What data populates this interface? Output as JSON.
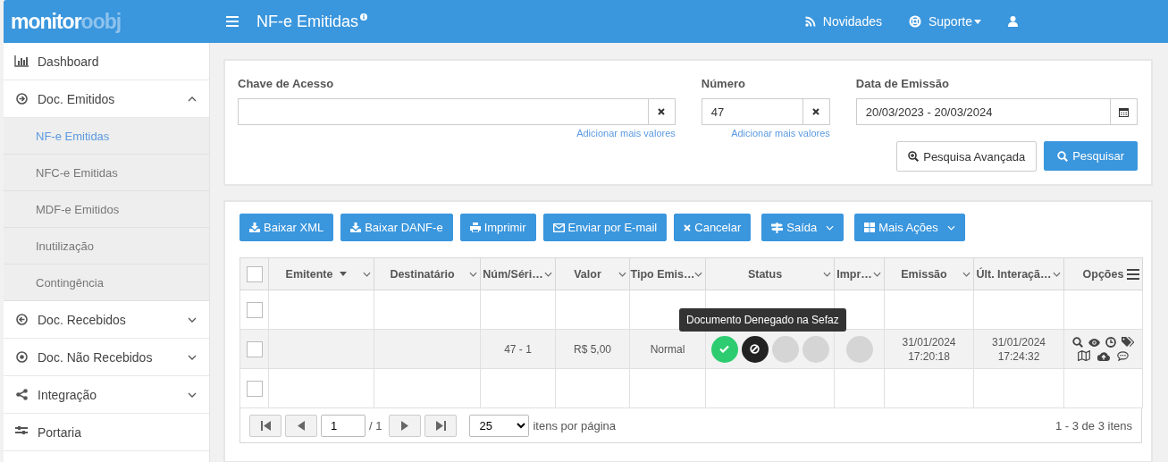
{
  "header": {
    "logo": {
      "primary": "monitor",
      "secondary": "oobj"
    },
    "title": "NF-e Emitidas",
    "nav": [
      {
        "kind": "news",
        "label": "Novidades"
      },
      {
        "kind": "support",
        "label": "Suporte",
        "dropdown": true
      },
      {
        "kind": "user"
      }
    ]
  },
  "sidebar": {
    "items": [
      {
        "kind": "link",
        "label": "Dashboard"
      },
      {
        "kind": "group",
        "label": "Doc. Emitidos",
        "expanded": true,
        "children": [
          {
            "label": "NF-e Emitidas",
            "selected": true
          },
          {
            "label": "NFC-e Emitidas",
            "selected": false
          },
          {
            "label": "MDF-e Emitidos",
            "selected": false
          },
          {
            "label": "Inutilização",
            "selected": false
          },
          {
            "label": "Contingência",
            "selected": false
          }
        ]
      },
      {
        "kind": "group",
        "label": "Doc. Recebidos",
        "expanded": false
      },
      {
        "kind": "group",
        "label": "Doc. Não Recebidos",
        "expanded": false
      },
      {
        "kind": "group",
        "label": "Integração",
        "expanded": false
      },
      {
        "kind": "link",
        "label": "Portaria"
      }
    ]
  },
  "filters": {
    "fields": [
      {
        "kind": "clearable",
        "label": "Chave de Acesso",
        "link": "Adicionar mais valores"
      },
      {
        "kind": "clearable",
        "label": "Número",
        "value": "47",
        "link": "Adicionar mais valores"
      },
      {
        "kind": "daterange",
        "label": "Data de Emissão",
        "value": "20/03/2023 - 20/03/2024"
      }
    ],
    "buttons": [
      {
        "kind": "default",
        "label": "Pesquisa Avançada"
      },
      {
        "kind": "primary",
        "label": "Pesquisar"
      }
    ]
  },
  "actions": [
    {
      "label": "Baixar XML",
      "dropdown": false
    },
    {
      "label": "Baixar DANF-e",
      "dropdown": false
    },
    {
      "label": "Imprimir",
      "dropdown": false
    },
    {
      "label": "Enviar por E-mail",
      "dropdown": false
    },
    {
      "label": "Cancelar",
      "dropdown": false
    },
    {
      "label": "Saída",
      "dropdown": true
    },
    {
      "label": "Mais Ações",
      "dropdown": true
    }
  ],
  "table": {
    "select_all": false,
    "columns": [
      {
        "label": "Emitente",
        "sorted": true,
        "kind": "filter"
      },
      {
        "label": "Destinatário",
        "sorted": false,
        "kind": "filter"
      },
      {
        "label": "Núm/Séri…",
        "sorted": false,
        "kind": "filter"
      },
      {
        "label": "Valor",
        "sorted": false,
        "kind": "filter"
      },
      {
        "label": "Tipo Emis…",
        "sorted": false,
        "kind": "filter"
      },
      {
        "label": "Status",
        "sorted": false,
        "kind": "filter"
      },
      {
        "label": "Impr…",
        "sorted": false,
        "kind": "filter"
      },
      {
        "label": "Emissão",
        "sorted": false,
        "kind": "filter"
      },
      {
        "label": "Últ. Interaçã…",
        "sorted": false,
        "kind": "filter"
      },
      {
        "label": "Opções",
        "sorted": false,
        "kind": "menu"
      }
    ],
    "rows": [
      {
        "checked": false,
        "highlighted": false,
        "options": false
      },
      {
        "checked": false,
        "highlighted": true,
        "options": true,
        "num_serie": "47 - 1",
        "valor": "R$ 5,00",
        "tipo": "Normal",
        "status": [
          {
            "kind": "authorized"
          },
          {
            "kind": "denied"
          },
          {
            "kind": "pending"
          },
          {
            "kind": "pending"
          }
        ],
        "impressao": {
          "kind": "pending"
        },
        "emissao": "31/01/2024\n17:20:18",
        "ultima_interacao": "31/01/2024\n17:24:32"
      },
      {
        "checked": false,
        "highlighted": false,
        "options": false
      }
    ],
    "tooltip": "Documento Denegado na Sefaz"
  },
  "pagination": {
    "page": "1",
    "pages": "/ 1",
    "page_size": "25",
    "page_size_label": "itens por página",
    "summary": "1 - 3 de 3 itens"
  }
}
